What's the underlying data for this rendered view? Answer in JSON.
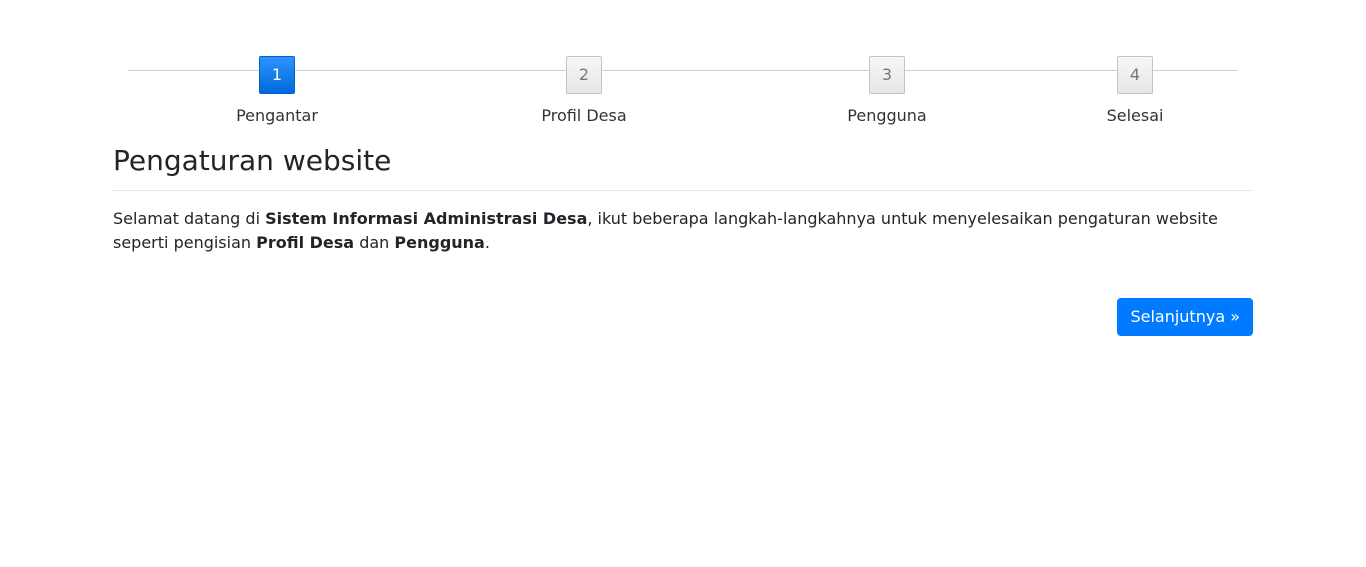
{
  "wizard": {
    "steps": [
      {
        "number": "1",
        "label": "Pengantar",
        "active": true
      },
      {
        "number": "2",
        "label": "Profil Desa",
        "active": false
      },
      {
        "number": "3",
        "label": "Pengguna",
        "active": false
      },
      {
        "number": "4",
        "label": "Selesai",
        "active": false
      }
    ]
  },
  "main": {
    "title": "Pengaturan website",
    "intro": {
      "part1": "Selamat datang di ",
      "app_name": "Sistem Informasi Administrasi Desa",
      "part2": ", ikut beberapa langkah-langkahnya untuk menyelesaikan pengaturan website seperti pengisian ",
      "item1": "Profil Desa",
      "part3": " dan ",
      "item2": "Pengguna",
      "part4": "."
    },
    "next_label": "Selanjutnya »"
  },
  "colors": {
    "accent": "#007bff",
    "text": "#212529",
    "step_inactive": "#e6e6e6"
  }
}
